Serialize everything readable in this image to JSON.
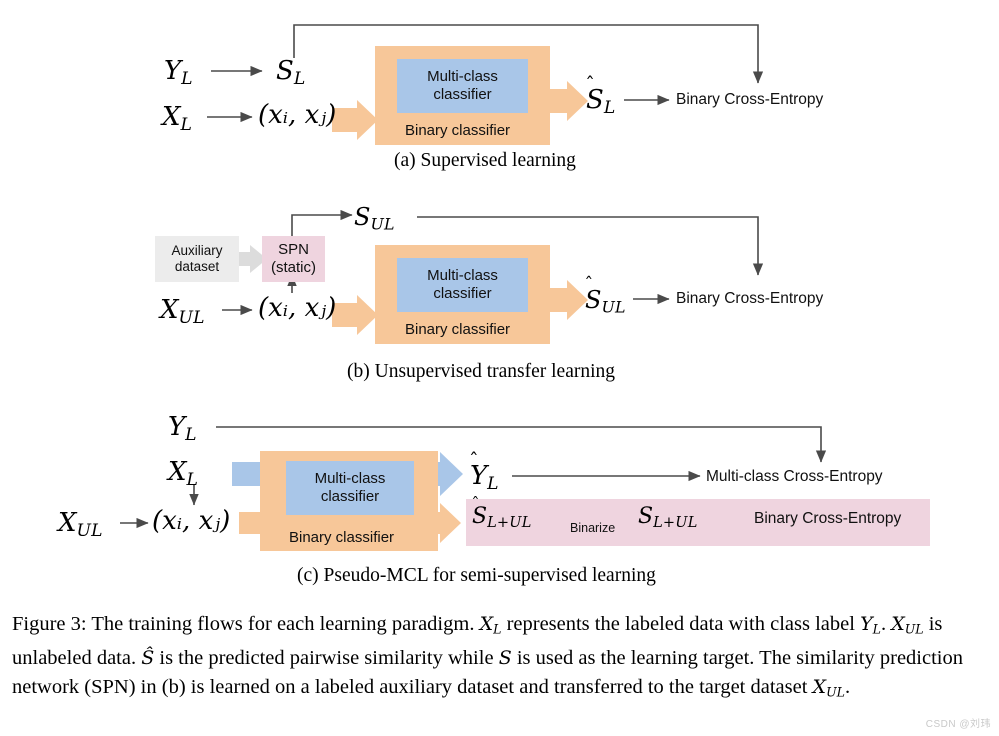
{
  "figure": {
    "number": "Figure 3",
    "caption_parts": {
      "p1": "Figure 3: The training flows for each learning paradigm. ",
      "m1": "X",
      "m1sub": "L",
      "p2": " represents the labeled data with class label ",
      "m2": "Y",
      "m2sub": "L",
      "p3": ". ",
      "m3": "X",
      "m3sub": "UL",
      "p4": " is unlabeled data. ",
      "m4": "Ŝ",
      "p5": " is the predicted pairwise similarity while ",
      "m5": "S",
      "p6": " is used as the learning target. The similarity prediction network (SPN) in (b) is learned on a labeled auxiliary dataset and transferred to the target dataset ",
      "m6": "X",
      "m6sub": "UL",
      "p7": "."
    },
    "watermark": "CSDN @刘玮"
  },
  "colors": {
    "orange": "#F7C799",
    "blue": "#A9C6E8",
    "pink": "#EFD4DF",
    "gray": "#ECECEC",
    "arrow_stroke": "#4a4a4a"
  },
  "panel_a": {
    "subcaption": "(a) Supervised learning",
    "inputs": {
      "y_label": "Y",
      "y_sub": "L",
      "x_label": "X",
      "x_sub": "L",
      "pair": "(xᵢ, xⱼ)",
      "s_label": "S",
      "s_sub": "L"
    },
    "model": {
      "multiclass_line1": "Multi-class",
      "multiclass_line2": "classifier",
      "binary_label": "Binary classifier"
    },
    "outputs": {
      "shat_label": "S",
      "shat_sub": "L",
      "loss": "Binary Cross-Entropy"
    }
  },
  "panel_b": {
    "subcaption": "(b) Unsupervised transfer learning",
    "inputs": {
      "aux_line1": "Auxiliary",
      "aux_line2": "dataset",
      "spn_line1": "SPN",
      "spn_line2": "(static)",
      "x_label": "X",
      "x_sub": "UL",
      "pair": "(xᵢ, xⱼ)",
      "s_label": "S",
      "s_sub": "UL"
    },
    "model": {
      "multiclass_line1": "Multi-class",
      "multiclass_line2": "classifier",
      "binary_label": "Binary classifier"
    },
    "outputs": {
      "shat_label": "S",
      "shat_sub": "UL",
      "loss": "Binary Cross-Entropy"
    }
  },
  "panel_c": {
    "subcaption": "(c) Pseudo-MCL for semi-supervised learning",
    "inputs": {
      "y_label": "Y",
      "y_sub": "L",
      "x_label": "X",
      "x_sub": "L",
      "xul_label": "X",
      "xul_sub": "UL",
      "pair": "(xᵢ, xⱼ)"
    },
    "model": {
      "multiclass_line1": "Multi-class",
      "multiclass_line2": "classifier",
      "binary_label": "Binary classifier"
    },
    "outputs": {
      "yhat_label": "Y",
      "yhat_sub": "L",
      "mc_loss": "Multi-class Cross-Entropy",
      "shat_label": "S",
      "shat_sub": "L+UL",
      "binarize_label": "Binarize",
      "s_label": "S",
      "s_sub": "L+UL",
      "bce_loss": "Binary Cross-Entropy"
    }
  }
}
